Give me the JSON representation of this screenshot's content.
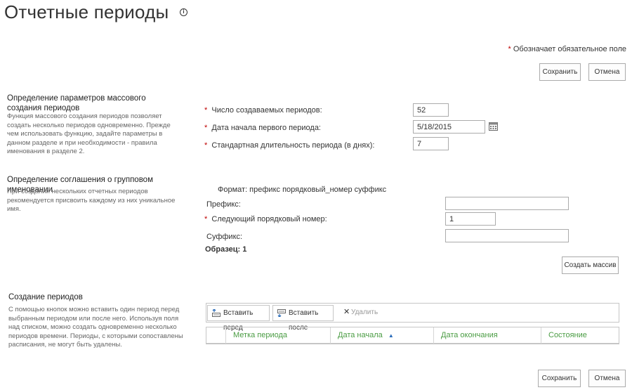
{
  "page": {
    "title": "Отчетные периоды"
  },
  "required_note": {
    "star": "*",
    "text": "Обозначает обязательное поле"
  },
  "top_buttons": {
    "save": "Сохранить",
    "cancel": "Отмена"
  },
  "bulk_section": {
    "title": "Определение параметров массового создания периодов",
    "description": "Функция массового создания периодов позволяет создать несколько периодов одновременно. Прежде чем использовать функцию, задайте параметры в данном разделе и при необходимости - правила именования в разделе 2.",
    "fields": {
      "count_label": "Число создаваемых периодов:",
      "count_value": "52",
      "start_label": "Дата начала первого периода:",
      "start_value": "5/18/2015",
      "length_label": "Стандартная длительность периода (в днях):",
      "length_value": "7"
    }
  },
  "naming_section": {
    "title": "Определение соглашения о групповом именовании",
    "description": "При создании нескольких отчетных периодов рекомендуется присвоить каждому из них уникальное имя.",
    "format_text": "Формат: префикс порядковый_номер суффикс",
    "prefix_label": "Префикс:",
    "prefix_value": "",
    "seq_label": "Следующий порядковый номер:",
    "seq_value": "1",
    "suffix_label": "Суффикс:",
    "suffix_value": "",
    "sample_text": "Образец: 1",
    "create_bulk_button": "Создать массив"
  },
  "create_section": {
    "title": "Создание периодов",
    "description": "С помощью кнопок можно вставить один период перед выбранным периодом или после него. Используя поля над списком, можно создать одновременно несколько периодов времени. Периоды, с которыми сопоставлены расписания, не могут быть удалены.",
    "toolbar": {
      "insert_before": "Вставить перед",
      "insert_after": "Вставить после",
      "delete": "Удалить"
    },
    "grid_columns": [
      "Метка периода",
      "Дата начала",
      "Дата окончания",
      "Состояние"
    ]
  },
  "bottom_buttons": {
    "save": "Сохранить",
    "cancel": "Отмена"
  },
  "colors": {
    "required_star": "#bf0000",
    "grid_header": "#4a9c43",
    "sort_arrow": "#2a6cba"
  }
}
